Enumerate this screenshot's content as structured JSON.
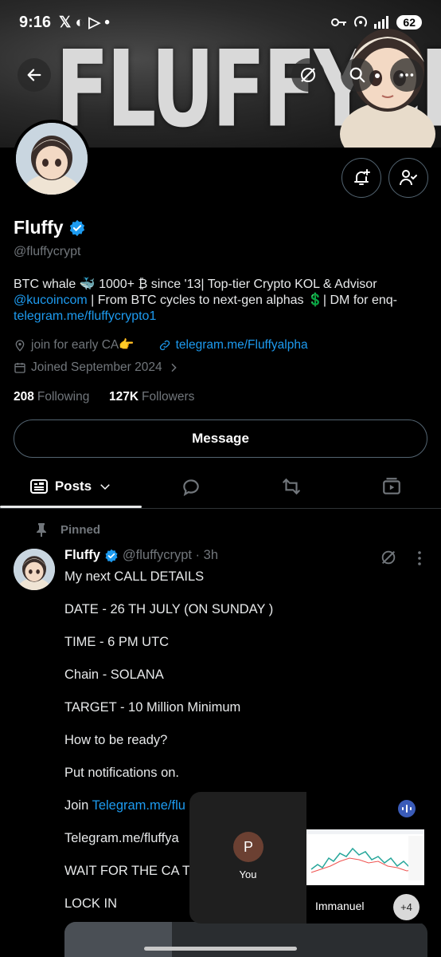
{
  "status_bar": {
    "time": "9:16",
    "left_icons": "𝕏 ◐ ▷ •",
    "battery": "62"
  },
  "banner": {
    "text": "FLUFFYCRYPT"
  },
  "profile": {
    "name": "Fluffy",
    "handle": "@fluffycrypt",
    "bio_1": "BTC whale 🐳 1000+ ₿ since '13| Top-tier Crypto KOL & Advisor",
    "bio_mention": "@kucoincom",
    "bio_2": " | From BTC cycles to next-gen alphas 💲| DM for enq-",
    "bio_link": "telegram.me/fluffycrypto1",
    "location": "join for early CA👉",
    "website": "telegram.me/Fluffyalpha",
    "joined": "Joined September 2024",
    "following_count": "208",
    "following_label": "Following",
    "followers_count": "127K",
    "followers_label": "Followers",
    "message_label": "Message"
  },
  "tabs": {
    "posts_label": "Posts"
  },
  "post": {
    "pinned_label": "Pinned",
    "name": "Fluffy",
    "meta": "@fluffycrypt · 3h",
    "lines": [
      "My next CALL DETAILS",
      "DATE - 26 TH JULY (ON SUNDAY )",
      "TIME - 6 PM UTC",
      "Chain - SOLANA",
      "TARGET - 10 Million Minimum",
      "How to be ready?",
      "Put notifications on.",
      "Join ",
      "WAIT FOR THE CA T",
      "LOCK IN"
    ],
    "link_1": "Telegram.me/flu",
    "link_2": "Telegram.me/fluffya"
  },
  "call": {
    "avatar_letter": "P",
    "you_label": "You",
    "participant": "Immanuel",
    "extra": "+4"
  },
  "colors": {
    "accent": "#1d9bf0",
    "verified": "#1d9bf0",
    "background": "#000000"
  }
}
